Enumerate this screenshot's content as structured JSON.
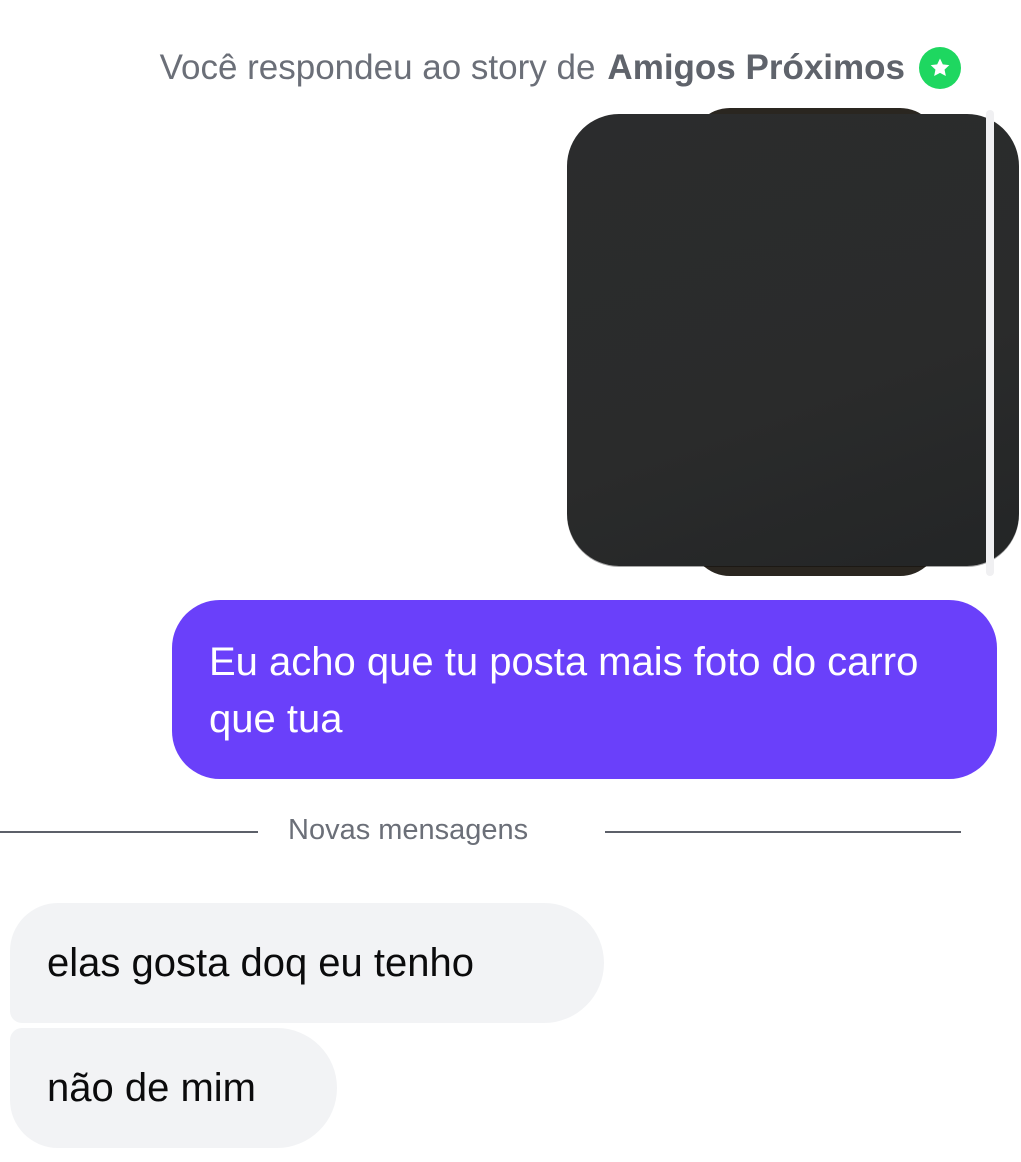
{
  "story_reply": {
    "prefix": "Você respondeu ao story de",
    "name": "Amigos Próximos",
    "badge_icon": "star-icon",
    "badge_color": "#1ed760"
  },
  "messages": {
    "outgoing": {
      "text": "Eu acho que tu posta mais foto do carro que tua",
      "bubble_color": "#6a40fa"
    },
    "divider_label": "Novas mensagens",
    "incoming": [
      {
        "text": "elas gosta doq eu tenho"
      },
      {
        "text": "não de mim"
      }
    ],
    "incoming_bubble_color": "#f2f3f5"
  }
}
